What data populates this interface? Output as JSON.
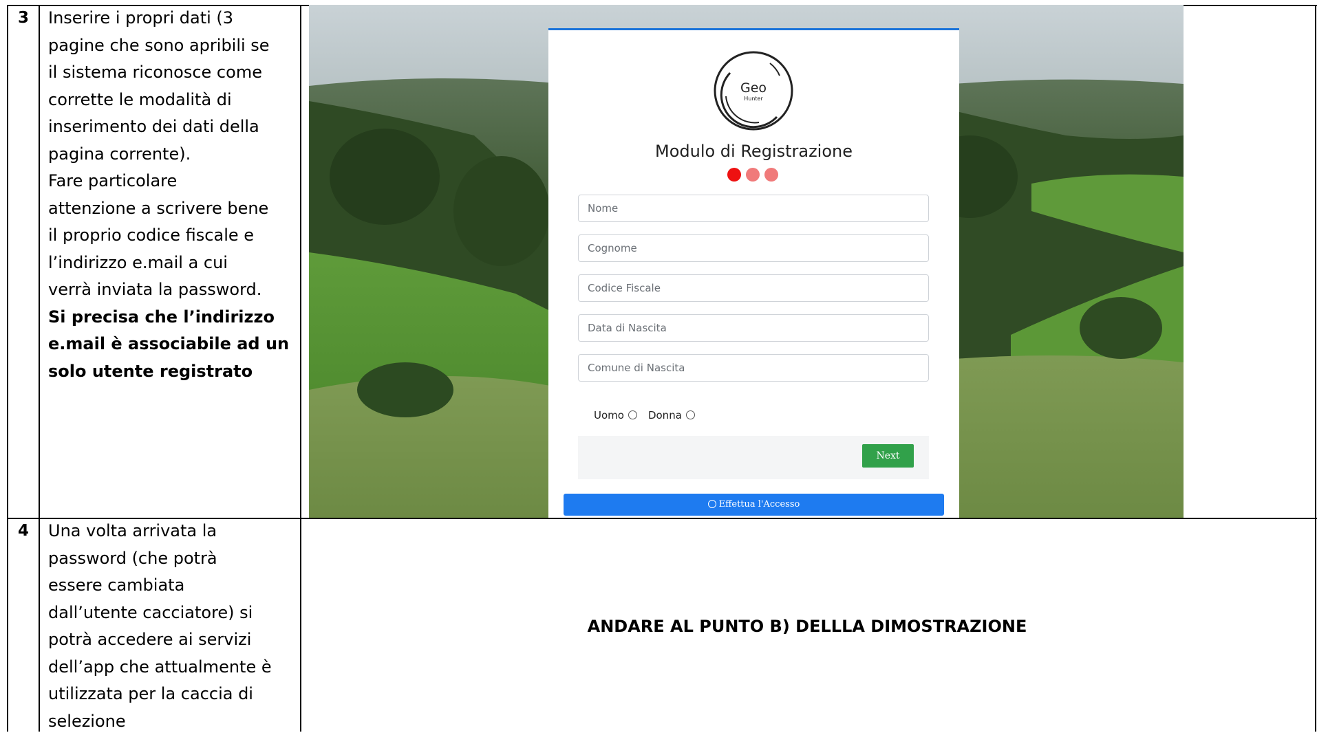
{
  "rows": [
    {
      "number": "3",
      "lines": [
        {
          "text": "Inserire i propri dati (3",
          "bold": false
        },
        {
          "text": "pagine che sono apribili se",
          "bold": false
        },
        {
          "text": "il sistema riconosce come",
          "bold": false
        },
        {
          "text": "corrette le modalità di",
          "bold": false
        },
        {
          "text": "inserimento dei dati della",
          "bold": false
        },
        {
          "text": "pagina corrente).",
          "bold": false
        },
        {
          "text": "Fare particolare",
          "bold": false
        },
        {
          "text": "attenzione a scrivere bene",
          "bold": false
        },
        {
          "text": "il proprio codice fiscale e",
          "bold": false
        },
        {
          "text": "l’indirizzo e.mail a cui",
          "bold": false
        },
        {
          "text": "verrà inviata la password.",
          "bold": false
        },
        {
          "text": "Si precisa che l’indirizzo",
          "bold": true
        },
        {
          "text": "e.mail è associabile ad un",
          "bold": true
        },
        {
          "text": "solo utente registrato",
          "bold": true
        }
      ]
    },
    {
      "number": "4",
      "lines": [
        {
          "text": "Una volta arrivata la",
          "bold": false
        },
        {
          "text": "password (che potrà",
          "bold": false
        },
        {
          "text": "essere cambiata",
          "bold": false
        },
        {
          "text": "dall’utente cacciatore) si",
          "bold": false
        },
        {
          "text": "potrà accedere ai servizi",
          "bold": false
        },
        {
          "text": "dell’app che attualmente è",
          "bold": false
        },
        {
          "text": "utilizzata per la caccia di",
          "bold": false
        },
        {
          "text": "selezione",
          "bold": false
        }
      ],
      "instruction": "ANDARE AL PUNTO B) DELLLA DIMOSTRAZIONE"
    }
  ],
  "form": {
    "logo_text": "Geo",
    "logo_subtext": "Hunter",
    "title": "Modulo di Registrazione",
    "steps": [
      {
        "color": "#ee1111"
      },
      {
        "color": "#f07a7a"
      },
      {
        "color": "#f07a7a"
      }
    ],
    "fields": [
      {
        "placeholder": "Nome"
      },
      {
        "placeholder": "Cognome"
      },
      {
        "placeholder": "Codice Fiscale"
      },
      {
        "placeholder": "Data di Nascita"
      },
      {
        "placeholder": "Comune di Nascita"
      }
    ],
    "gender_options": [
      "Uomo",
      "Donna"
    ],
    "next_label": "Next",
    "login_label": "Effettua l'Accesso"
  },
  "colors": {
    "accent_blue": "#1e7bf0",
    "next_green": "#31a14a"
  }
}
